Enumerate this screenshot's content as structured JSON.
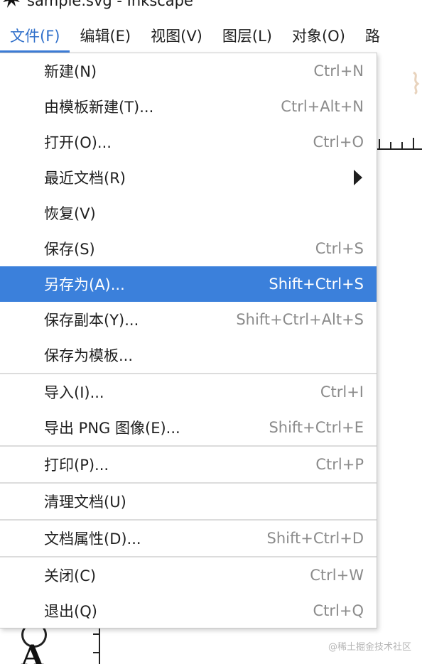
{
  "window": {
    "title": "sample.svg - Inkscape"
  },
  "menubar": {
    "items": [
      {
        "label": "文件(F)"
      },
      {
        "label": "编辑(E)"
      },
      {
        "label": "视图(V)"
      },
      {
        "label": "图层(L)"
      },
      {
        "label": "对象(O)"
      },
      {
        "label": "路"
      }
    ]
  },
  "file_menu": {
    "items": [
      {
        "label": "新建(N)",
        "shortcut": "Ctrl+N"
      },
      {
        "label": "由模板新建(T)...",
        "shortcut": "Ctrl+Alt+N"
      },
      {
        "label": "打开(O)...",
        "shortcut": "Ctrl+O"
      },
      {
        "label": "最近文档(R)",
        "shortcut": ""
      },
      {
        "label": "恢复(V)",
        "shortcut": ""
      },
      {
        "label": "保存(S)",
        "shortcut": "Ctrl+S"
      },
      {
        "label": "另存为(A)...",
        "shortcut": "Shift+Ctrl+S"
      },
      {
        "label": "保存副本(Y)...",
        "shortcut": "Shift+Ctrl+Alt+S"
      },
      {
        "label": "保存为模板...",
        "shortcut": ""
      },
      {
        "label": "导入(I)...",
        "shortcut": "Ctrl+I"
      },
      {
        "label": "导出 PNG 图像(E)...",
        "shortcut": "Shift+Ctrl+E"
      },
      {
        "label": "打印(P)...",
        "shortcut": "Ctrl+P"
      },
      {
        "label": "清理文档(U)",
        "shortcut": ""
      },
      {
        "label": "文档属性(D)...",
        "shortcut": "Shift+Ctrl+D"
      },
      {
        "label": "关闭(C)",
        "shortcut": "Ctrl+W"
      },
      {
        "label": "退出(Q)",
        "shortcut": "Ctrl+Q"
      }
    ]
  },
  "canvas": {
    "tool_letter": "A"
  },
  "watermark": "@稀土掘金技术社区",
  "colors": {
    "highlight": "#3b80db",
    "active_menu": "#2f6fca"
  }
}
